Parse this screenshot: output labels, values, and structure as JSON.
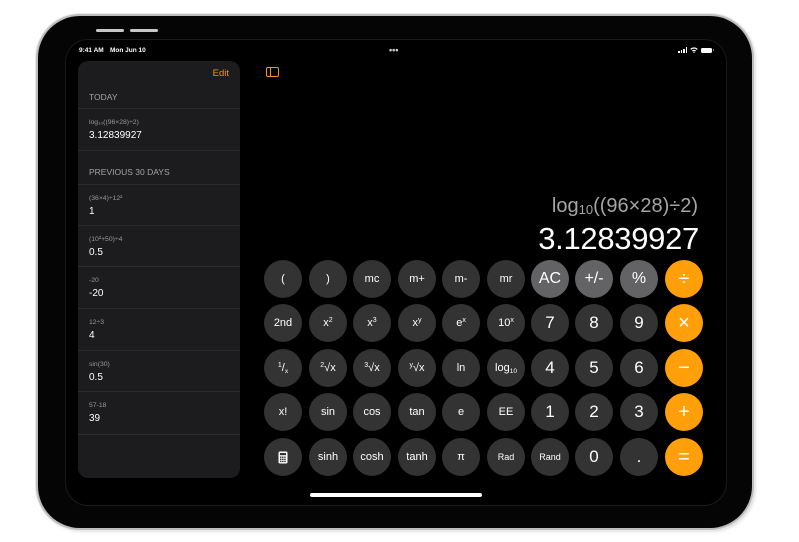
{
  "status_bar": {
    "time": "9:41 AM",
    "date": "Mon Jun 10",
    "multitask_indicator": "•••",
    "icons": [
      "cellular-signal-icon",
      "wifi-icon",
      "battery-icon"
    ]
  },
  "colors": {
    "accent": "#f0961f",
    "operator": "#ff9f0a",
    "function_key": "#333333",
    "utility_key": "#636366",
    "sidebar_bg": "#1c1c1e",
    "screen_bg": "#000000"
  },
  "sidebar": {
    "edit_label": "Edit",
    "sections": [
      {
        "title": "TODAY",
        "items": [
          {
            "expression": "log₁₀((96×28)÷2)",
            "result": "3.12839927"
          }
        ]
      },
      {
        "title": "PREVIOUS 30 DAYS",
        "items": [
          {
            "expression": "(36×4)÷12²",
            "result": "1"
          },
          {
            "expression": "(10²+50)÷4",
            "result": "0.5"
          },
          {
            "expression": "-20",
            "result": "-20"
          },
          {
            "expression": "12÷3",
            "result": "4"
          },
          {
            "expression": "sin(30)",
            "result": "0.5"
          },
          {
            "expression": "57-18",
            "result": "39"
          }
        ]
      }
    ]
  },
  "display": {
    "expression_prefix": "log",
    "expression_sub": "10",
    "expression_rest": "((96×28)÷2)",
    "result": "3.12839927"
  },
  "keypad": {
    "rows": [
      [
        "(",
        ")",
        "mc",
        "m+",
        "m-",
        "mr",
        "AC",
        "+/-",
        "%",
        "÷"
      ],
      [
        "2nd",
        "x²",
        "x³",
        "xʸ",
        "eˣ",
        "10ˣ",
        "7",
        "8",
        "9",
        "×"
      ],
      [
        "¹/x",
        "²√x",
        "³√x",
        "ʸ√x",
        "ln",
        "log₁₀",
        "4",
        "5",
        "6",
        "−"
      ],
      [
        "x!",
        "sin",
        "cos",
        "tan",
        "e",
        "EE",
        "1",
        "2",
        "3",
        "+"
      ],
      [
        "calculator-icon",
        "sinh",
        "cosh",
        "tanh",
        "π",
        "Rad",
        "Rand",
        "0",
        ".",
        "="
      ]
    ]
  }
}
